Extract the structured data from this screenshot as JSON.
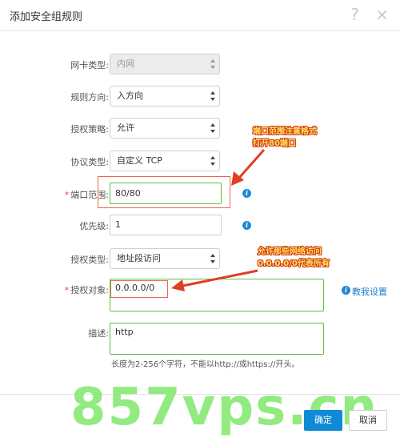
{
  "dialog": {
    "title": "添加安全组规则",
    "help_icon": "?",
    "close_icon": "×"
  },
  "form": {
    "nic_type": {
      "label": "网卡类型:",
      "value": "内网"
    },
    "direction": {
      "label": "规则方向:",
      "value": "入方向"
    },
    "policy": {
      "label": "授权策略:",
      "value": "允许"
    },
    "protocol": {
      "label": "协议类型:",
      "value": "自定义 TCP"
    },
    "port_range": {
      "required": "*",
      "label": "端口范围:",
      "value": "80/80"
    },
    "priority": {
      "label": "优先级:",
      "value": "1"
    },
    "auth_type": {
      "label": "授权类型:",
      "value": "地址段访问"
    },
    "auth_object": {
      "required": "*",
      "label": "授权对象:",
      "value": "0.0.0.0/0",
      "help_link": "教我设置"
    },
    "description": {
      "label": "描述:",
      "value": "http",
      "hint": "长度为2-256个字符，不能以http://或https://开头。"
    }
  },
  "annotations": {
    "port_note_line1": "端口范围注意格式",
    "port_note_line2": "打开80端口",
    "object_note_line1": "允许那些网络访问",
    "object_note_line2": "0.0.0.0/0代表所有"
  },
  "footer": {
    "confirm_label": "确定",
    "cancel_label": "取消"
  },
  "watermark": "857vps.cn",
  "colors": {
    "primary": "#0f8bd6",
    "highlight_green": "#5fbf3f",
    "highlight_red": "#e8674a",
    "required": "#e64b3b",
    "watermark": "#7ee86a"
  },
  "icons": [
    "help-icon",
    "close-icon",
    "info-icon",
    "chevron-updown-icon"
  ]
}
